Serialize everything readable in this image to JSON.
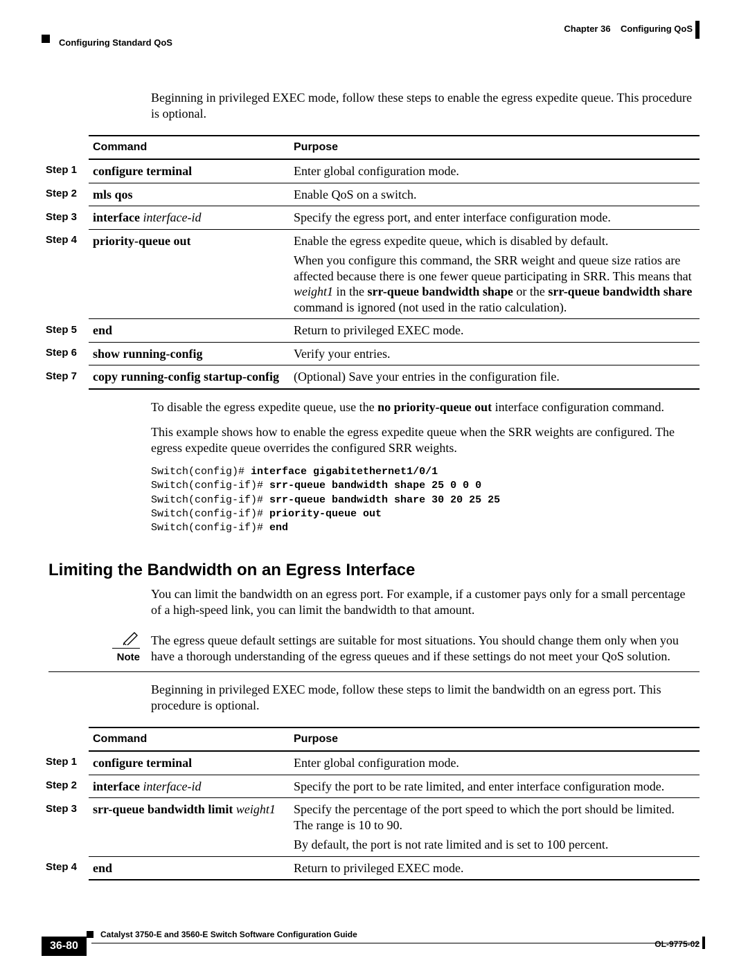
{
  "header": {
    "chapter_label": "Chapter 36",
    "chapter_title": "Configuring QoS",
    "section": "Configuring Standard QoS"
  },
  "intro1": "Beginning in privileged EXEC mode, follow these steps to enable the egress expedite queue. This procedure is optional.",
  "table_a": {
    "head_command": "Command",
    "head_purpose": "Purpose",
    "rows": [
      {
        "step": "Step 1",
        "cmd_b": "configure terminal",
        "cmd_i": "",
        "purpose": "Enter global configuration mode."
      },
      {
        "step": "Step 2",
        "cmd_b": "mls qos",
        "cmd_i": "",
        "purpose": "Enable QoS on a switch."
      },
      {
        "step": "Step 3",
        "cmd_b": "interface",
        "cmd_i": " interface-id",
        "purpose": "Specify the egress port, and enter interface configuration mode."
      },
      {
        "step": "Step 4",
        "cmd_b": "priority-queue out",
        "cmd_i": "",
        "purpose": "Enable the egress expedite queue, which is disabled by default.",
        "sub_pre": "When you configure this command, the SRR weight and queue size ratios are affected because there is one fewer queue participating in SRR. This means that ",
        "sub_i1": "weight1",
        "sub_mid1": " in the ",
        "sub_b1": "srr-queue bandwidth shape",
        "sub_mid2": " or the ",
        "sub_b2": "srr-queue bandwidth share",
        "sub_post": " command is ignored (not used in the ratio calculation)."
      },
      {
        "step": "Step 5",
        "cmd_b": "end",
        "cmd_i": "",
        "purpose": "Return to privileged EXEC mode."
      },
      {
        "step": "Step 6",
        "cmd_b": "show running-config",
        "cmd_i": "",
        "purpose": "Verify your entries."
      },
      {
        "step": "Step 7",
        "cmd_b": "copy running-config startup-config",
        "cmd_i": "",
        "purpose": "(Optional) Save your entries in the configuration file."
      }
    ]
  },
  "after_table_a": {
    "p1_pre": "To disable the egress expedite queue, use the ",
    "p1_b": "no priority-queue out",
    "p1_post": " interface configuration command.",
    "p2": "This example shows how to enable the egress expedite queue when the SRR weights are configured. The egress expedite queue overrides the configured SRR weights."
  },
  "code": {
    "l1a": "Switch(config)# ",
    "l1b": "interface gigabitethernet1/0/1",
    "l2a": "Switch(config-if)# ",
    "l2b": "srr-queue bandwidth shape 25 0 0 0",
    "l3a": "Switch(config-if)# ",
    "l3b": "srr-queue bandwidth share 30 20 25 25",
    "l4a": "Switch(config-if)# ",
    "l4b": "priority-queue out",
    "l5a": "Switch(config-if)# ",
    "l5b": "end"
  },
  "section2_title": "Limiting the Bandwidth on an Egress Interface",
  "section2_p1": "You can limit the bandwidth on an egress port. For example, if a customer pays only for a small percentage of a high-speed link, you can limit the bandwidth to that amount.",
  "note": {
    "label": "Note",
    "text": "The egress queue default settings are suitable for most situations. You should change them only when you have a thorough understanding of the egress queues and if these settings do not meet your QoS solution."
  },
  "section2_p2": "Beginning in privileged EXEC mode, follow these steps to limit the bandwidth on an egress port. This procedure is optional.",
  "table_b": {
    "head_command": "Command",
    "head_purpose": "Purpose",
    "rows": [
      {
        "step": "Step 1",
        "cmd_b": "configure terminal",
        "cmd_i": "",
        "purpose": "Enter global configuration mode."
      },
      {
        "step": "Step 2",
        "cmd_b": "interface",
        "cmd_i": " interface-id",
        "purpose": "Specify the port to be rate limited, and enter interface configuration mode."
      },
      {
        "step": "Step 3",
        "cmd_b": "srr-queue bandwidth limit",
        "cmd_i": " weight1",
        "purpose": "Specify the percentage of the port speed to which the port should be limited. The range is 10 to 90.",
        "sub_plain": "By default, the port is not rate limited and is set to 100 percent."
      },
      {
        "step": "Step 4",
        "cmd_b": "end",
        "cmd_i": "",
        "purpose": "Return to privileged EXEC mode."
      }
    ]
  },
  "footer": {
    "book": "Catalyst 3750-E and 3560-E Switch Software Configuration Guide",
    "page": "36-80",
    "docnum": "OL-9775-02"
  }
}
